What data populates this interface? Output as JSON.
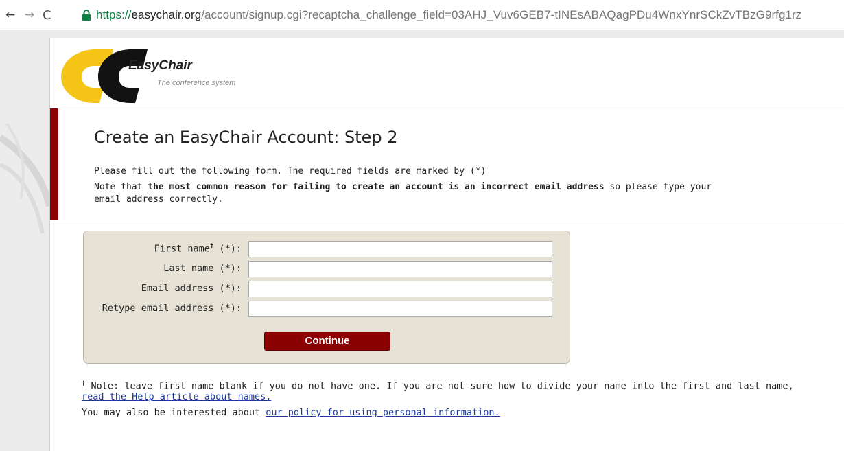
{
  "browser": {
    "back_glyph": "←",
    "forward_glyph": "→",
    "reload_glyph": "C",
    "url_scheme": "https://",
    "url_host": "easychair.org",
    "url_path": "/account/signup.cgi?recaptcha_challenge_field=03AHJ_Vuv6GEB7-tINEsABAQagPDu4WnxYnrSCkZvTBzG9rfg1rz"
  },
  "logo": {
    "name": "EasyChair",
    "tagline": "The conference system"
  },
  "intro": {
    "title": "Create an EasyChair Account: Step 2",
    "line1": "Please fill out the following form. The required fields are marked by (*)",
    "line2_prefix": "Note that ",
    "line2_bold": "the most common reason for failing to create an account is an incorrect email address",
    "line2_suffix": " so please type your",
    "line3": "email address correctly."
  },
  "form": {
    "first_name_label": "First name",
    "first_name_dagger": "†",
    "first_name_suffix": " (*):",
    "last_name_label": "Last name (*):",
    "email_label": "Email address (*):",
    "retype_email_label": "Retype email address (*):",
    "first_name_value": "",
    "last_name_value": "",
    "email_value": "",
    "retype_email_value": "",
    "continue_label": "Continue"
  },
  "notes": {
    "dagger": "†",
    "line1": " Note: leave first name blank if you do not have one. If you are not sure how to divide your name into the first and last name,",
    "help_link": "read the Help article about names.",
    "line3_prefix": "You may also be interested about ",
    "policy_link": "our policy for using personal information."
  },
  "colors": {
    "accent_red": "#8b0000",
    "form_background": "#e6e2d6",
    "logo_yellow": "#f5c518",
    "logo_black": "#111111",
    "link_blue": "#1a3a9c",
    "url_green": "#0b8043"
  }
}
